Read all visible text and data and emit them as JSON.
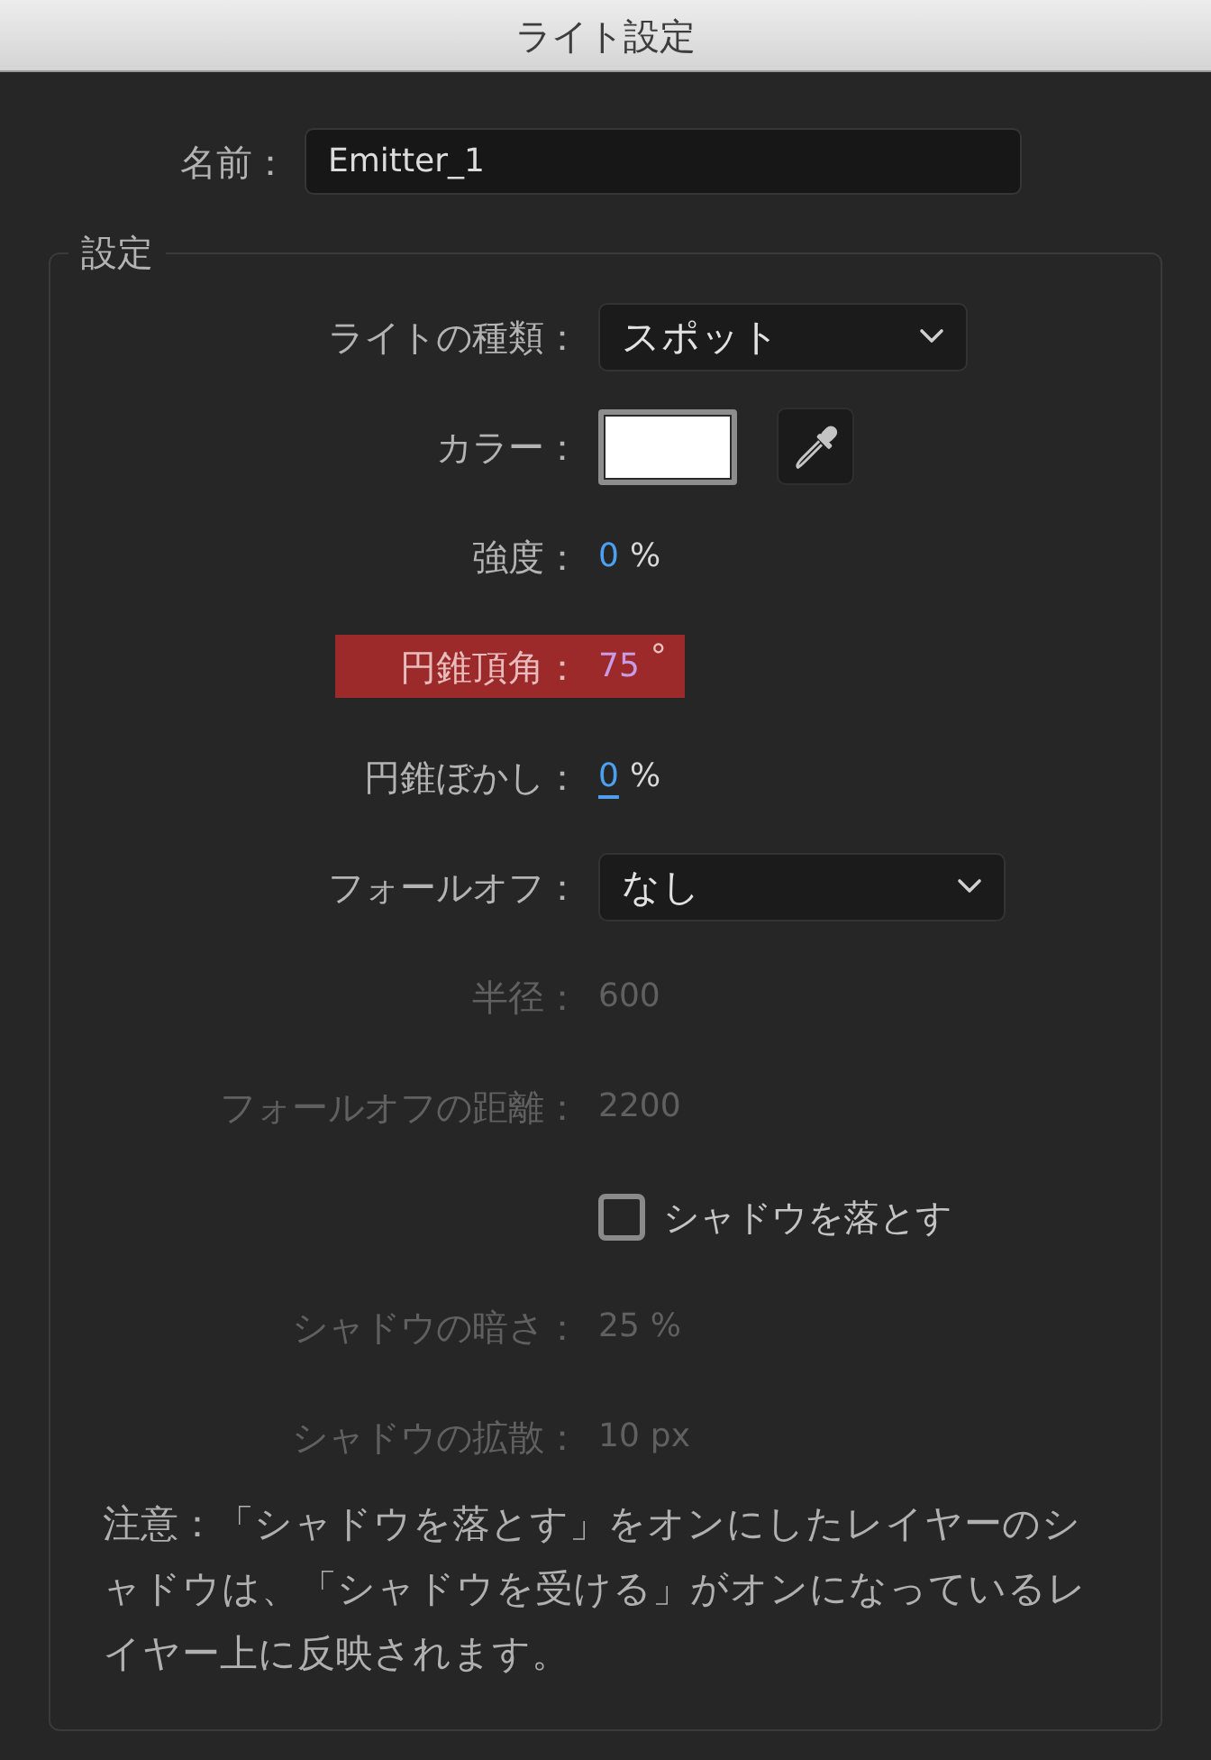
{
  "window": {
    "title": "ライト設定"
  },
  "name": {
    "label": "名前：",
    "value": "Emitter_1"
  },
  "settings": {
    "title": "設定",
    "rows": [
      {
        "kind": "dropdown",
        "label": "ライトの種類：",
        "value": "スポット",
        "disabled": false,
        "highlighted": false
      },
      {
        "kind": "color",
        "label": "カラー：",
        "color": "#ffffff",
        "disabled": false,
        "highlighted": false
      },
      {
        "kind": "value",
        "label": "強度：",
        "value": "0",
        "unit": "%",
        "disabled": false,
        "highlighted": false,
        "focused": false
      },
      {
        "kind": "value",
        "label": "円錐頂角：",
        "value": "75",
        "unit": "°",
        "disabled": false,
        "highlighted": true,
        "focused": false
      },
      {
        "kind": "value",
        "label": "円錐ぼかし：",
        "value": "0",
        "unit": "%",
        "disabled": false,
        "highlighted": false,
        "focused": true
      },
      {
        "kind": "dropdown",
        "label": "フォールオフ：",
        "value": "なし",
        "disabled": false,
        "highlighted": false
      },
      {
        "kind": "value",
        "label": "半径：",
        "value": "600",
        "disabled": true,
        "highlighted": false,
        "focused": false
      },
      {
        "kind": "value",
        "label": "フォールオフの距離：",
        "value": "2200",
        "disabled": true,
        "highlighted": false,
        "focused": false
      },
      {
        "kind": "checkbox",
        "label": "シャドウを落とす",
        "checked": false,
        "disabled": false,
        "highlighted": false
      },
      {
        "kind": "value",
        "label": "シャドウの暗さ：",
        "value": "25",
        "unit": "%",
        "disabled": true,
        "highlighted": false,
        "focused": false
      },
      {
        "kind": "value",
        "label": "シャドウの拡散：",
        "value": "10",
        "unit": "px",
        "disabled": true,
        "highlighted": false,
        "focused": false
      }
    ],
    "note": "注意：「シャドウを落とす」をオンにしたレイヤーのシャドウは、「シャドウを受ける」がオンになっているレイヤー上に反映されます。"
  }
}
